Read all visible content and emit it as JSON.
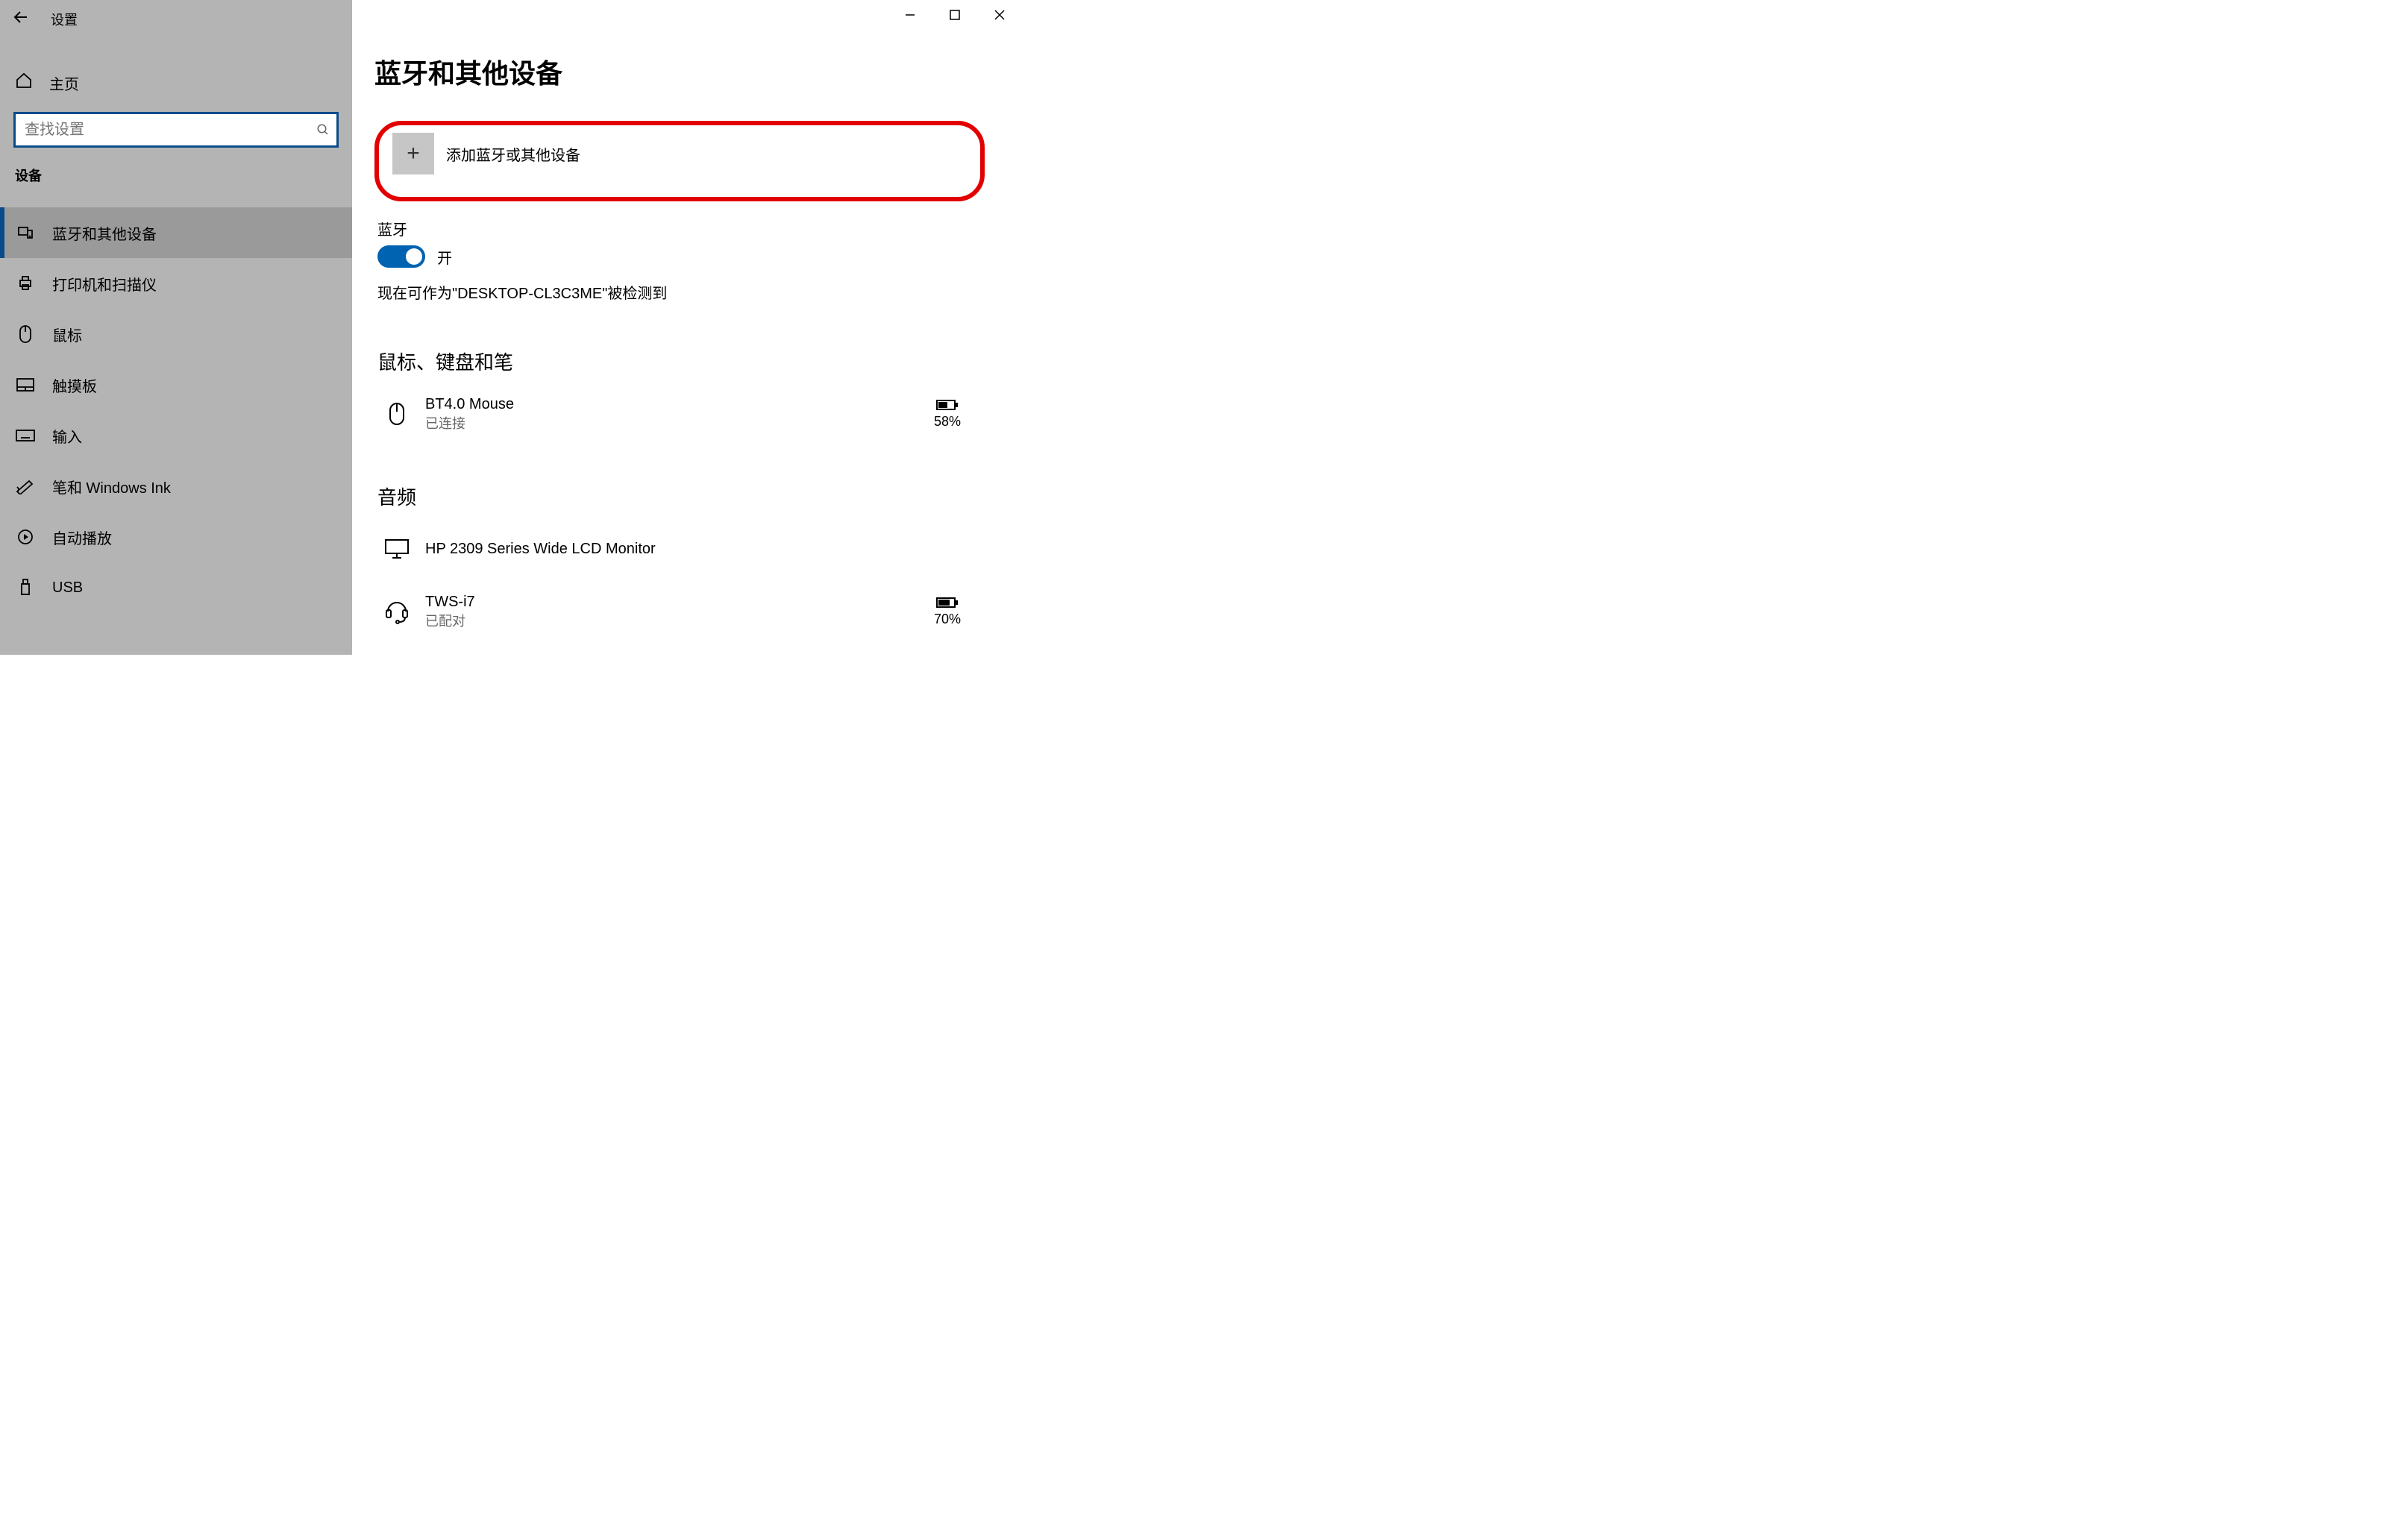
{
  "titlebar": {
    "app_name": "设置"
  },
  "sidebar": {
    "home_label": "主页",
    "search_placeholder": "查找设置",
    "category_label": "设备",
    "items": [
      {
        "icon": "bluetooth-devices-icon",
        "label": "蓝牙和其他设备",
        "active": true
      },
      {
        "icon": "printer-icon",
        "label": "打印机和扫描仪",
        "active": false
      },
      {
        "icon": "mouse-icon",
        "label": "鼠标",
        "active": false
      },
      {
        "icon": "touchpad-icon",
        "label": "触摸板",
        "active": false
      },
      {
        "icon": "keyboard-icon",
        "label": "输入",
        "active": false
      },
      {
        "icon": "pen-icon",
        "label": "笔和 Windows Ink",
        "active": false
      },
      {
        "icon": "autoplay-icon",
        "label": "自动播放",
        "active": false
      },
      {
        "icon": "usb-icon",
        "label": "USB",
        "active": false
      }
    ]
  },
  "main": {
    "page_title": "蓝牙和其他设备",
    "add_device_label": "添加蓝牙或其他设备",
    "bluetooth_label": "蓝牙",
    "toggle_status": "开",
    "discoverable_text": "现在可作为\"DESKTOP-CL3C3ME\"被检测到",
    "sections": [
      {
        "heading": "鼠标、键盘和笔",
        "devices": [
          {
            "icon": "mouse",
            "name": "BT4.0 Mouse",
            "status": "已连接",
            "battery": "58%"
          }
        ]
      },
      {
        "heading": "音频",
        "devices": [
          {
            "icon": "monitor",
            "name": "HP 2309 Series Wide LCD Monitor",
            "status": "",
            "battery": ""
          },
          {
            "icon": "headset",
            "name": "TWS-i7",
            "status": "已配对",
            "battery": "70%"
          }
        ]
      }
    ]
  }
}
